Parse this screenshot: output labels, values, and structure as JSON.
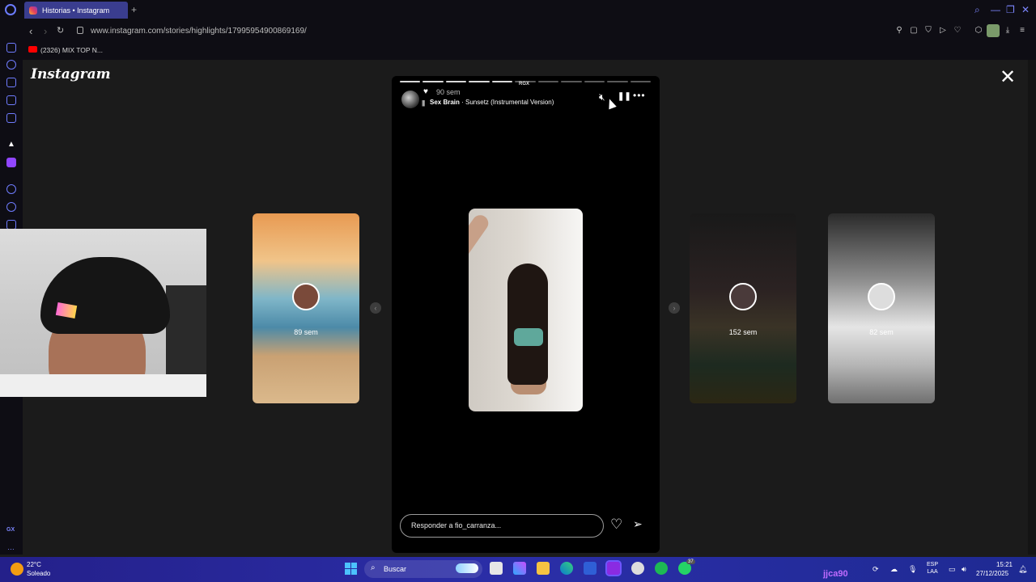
{
  "browser": {
    "tab_title": "Historias • Instagram",
    "new_tab": "+",
    "url": "www.instagram.com/stories/highlights/17995954900869169/",
    "bookmark": "(2326) MIX TOP N..."
  },
  "instagram": {
    "logo": "Instagram",
    "close": "✕"
  },
  "main_story": {
    "progress": {
      "total_segments": 11,
      "completed": 5
    },
    "overlay_label": "RGX",
    "age": "90 sem",
    "song_artist": "Sex Brain",
    "song_title": " · Sunsetz (Instrumental Version)",
    "reply_placeholder": "Responder a fio_carranza...",
    "icons": {
      "mute": "speaker-muted-icon",
      "pause": "pause-icon",
      "more": "more-icon",
      "like": "heart-icon",
      "share": "send-icon"
    }
  },
  "side_stories": [
    {
      "label": "89 sem"
    },
    {
      "label": "152 sem"
    },
    {
      "label": "82 sem"
    }
  ],
  "taskbar": {
    "temperature": "22°C",
    "condition": "Soleado",
    "search": "Buscar",
    "user": "jjca90",
    "lang_1": "ESP",
    "lang_2": "LAA",
    "time": "15:21",
    "date": "27/12/2025",
    "badge": "37"
  },
  "colors": {
    "accent": "#3a3d8f",
    "taskbar": "#2b2ea8",
    "story_bg": "#000000"
  }
}
